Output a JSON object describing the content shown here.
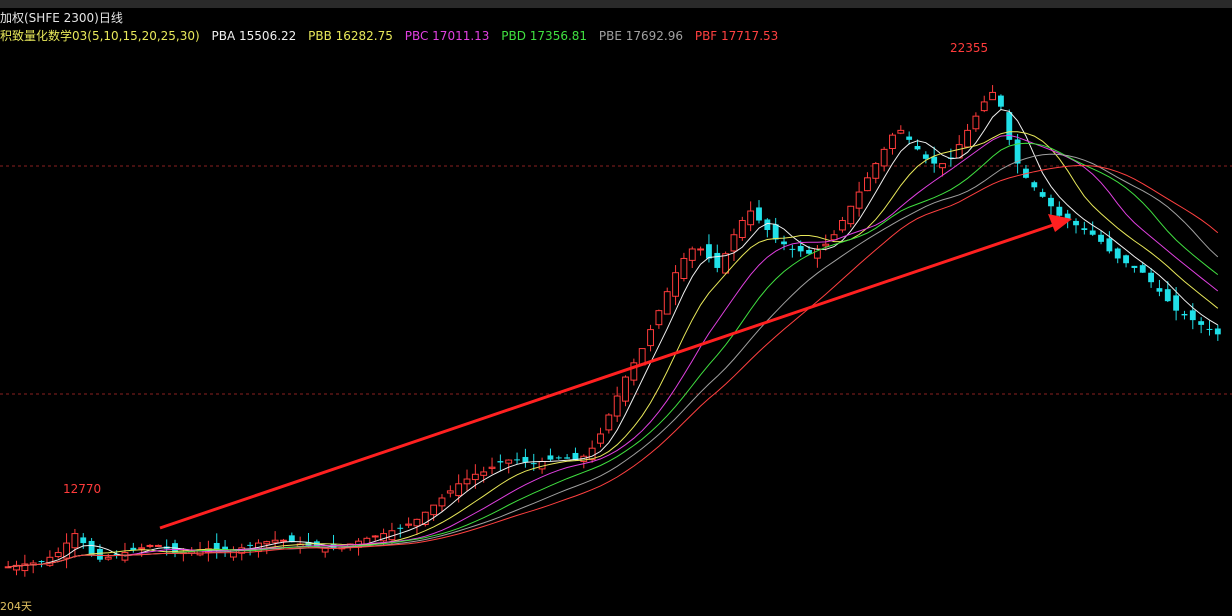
{
  "header": {
    "title": "加权(SHFE 2300)日线",
    "indicator_name": "积致量化数学03(5,10,15,20,25,30)"
  },
  "legend": [
    {
      "label": "PBA 15506.22",
      "color": "#f0f0f0"
    },
    {
      "label": "PBB 16282.75",
      "color": "#e8e85a"
    },
    {
      "label": "PBC 17011.13",
      "color": "#e040e0"
    },
    {
      "label": "PBD 17356.81",
      "color": "#40e040"
    },
    {
      "label": "PBE 17692.96",
      "color": "#a0a0a0"
    },
    {
      "label": "PBF 17717.53",
      "color": "#ff4040"
    }
  ],
  "footer": {
    "days_label": "204天"
  },
  "chart_data": {
    "type": "candlestick",
    "instrument": "SHFE 2300",
    "period": "daily",
    "price_range": [
      11300,
      23000
    ],
    "annotations": {
      "low_peak": 12770,
      "high_peak": 22355
    },
    "candle_up_color": "#ff3b3b",
    "candle_down_color": "#20e0e8",
    "trend_arrow_color": "#ff2020",
    "closes": [
      12000,
      12030,
      12060,
      12080,
      12100,
      12200,
      12300,
      12500,
      12700,
      12500,
      12250,
      12150,
      12200,
      12250,
      12300,
      12350,
      12400,
      12450,
      12450,
      12380,
      12300,
      12300,
      12320,
      12360,
      12380,
      12360,
      12330,
      12360,
      12400,
      12450,
      12500,
      12530,
      12560,
      12560,
      12520,
      12480,
      12450,
      12420,
      12400,
      12380,
      12420,
      12480,
      12540,
      12600,
      12650,
      12700,
      12760,
      12820,
      12900,
      13000,
      13150,
      13300,
      13450,
      13600,
      13750,
      13850,
      13950,
      14000,
      14100,
      14200,
      14250,
      14250,
      14200,
      14180,
      14220,
      14260,
      14300,
      14280,
      14250,
      14330,
      14500,
      14800,
      15200,
      15600,
      16000,
      16300,
      16600,
      17000,
      17400,
      17800,
      18200,
      18500,
      18700,
      18700,
      18500,
      18300,
      18600,
      19000,
      19300,
      19500,
      19300,
      19100,
      18900,
      18800,
      18700,
      18650,
      18600,
      18700,
      18800,
      19000,
      19300,
      19600,
      19900,
      20200,
      20500,
      20800,
      21100,
      21200,
      21000,
      20800,
      20600,
      20500,
      20500,
      20600,
      20900,
      21200,
      21500,
      21800,
      22000,
      21700,
      21000,
      20500,
      20200,
      20000,
      19800,
      19600,
      19400,
      19300,
      19200,
      19100,
      19000,
      18850,
      18650,
      18500,
      18400,
      18300,
      18200,
      18000,
      17800,
      17600,
      17400,
      17300,
      17200,
      17100,
      17000,
      16900
    ]
  }
}
